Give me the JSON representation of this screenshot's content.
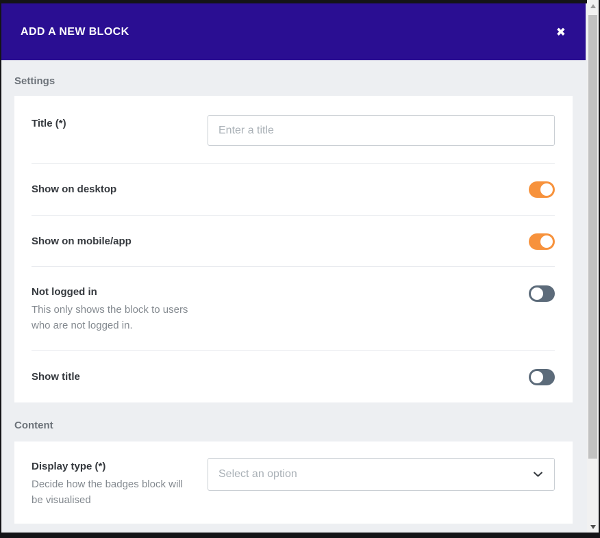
{
  "header": {
    "title": "ADD A NEW BLOCK",
    "close_icon": "✖"
  },
  "settings_section": {
    "label": "Settings",
    "title_row": {
      "label": "Title (*)",
      "input_value": "",
      "input_placeholder": "Enter a title"
    },
    "toggle_rows": [
      {
        "label": "Show on desktop",
        "state": "on"
      },
      {
        "label": "Show on mobile/app",
        "state": "on"
      },
      {
        "label": "Not logged in",
        "description": "This only shows the block to users\nwho are not logged in.",
        "state": "off"
      },
      {
        "label": "Show title",
        "state": "off"
      }
    ]
  },
  "content_section": {
    "label": "Content",
    "display_type_row": {
      "label": "Display type (*)",
      "description": "Decide how the badges block will\nbe visualised",
      "select_placeholder": "Select an option"
    }
  },
  "colors": {
    "header_bg": "#2a0e92",
    "toggle_on": "#f7923c",
    "toggle_off": "#5c6b7a",
    "modal_bg": "#edeff2",
    "card_bg": "#ffffff"
  }
}
